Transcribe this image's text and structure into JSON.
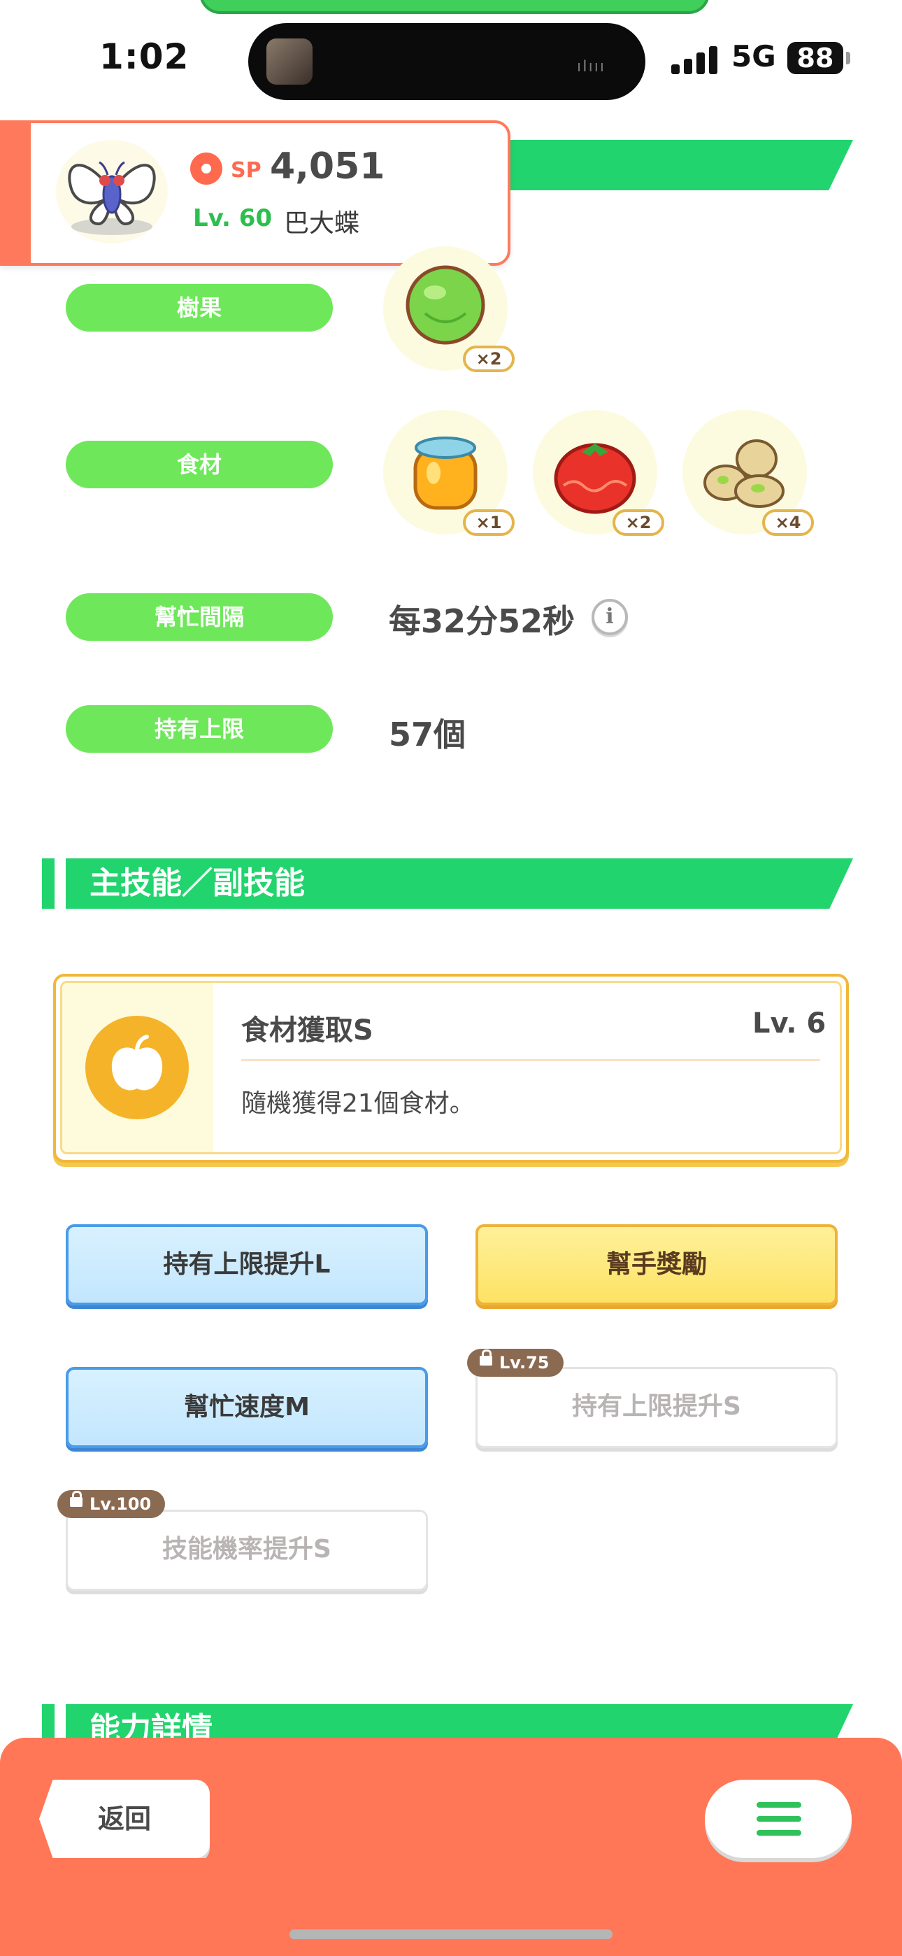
{
  "status_bar": {
    "time": "1:02",
    "network": "5G",
    "battery": "88"
  },
  "pokemon": {
    "sp_label": "SP",
    "sp_value": "4,051",
    "level": "Lv. 60",
    "name": "巴大蝶"
  },
  "rows": {
    "berry_label": "樹果",
    "berry": {
      "icon": "green-berry-icon",
      "count": "×2"
    },
    "ingredients_label": "食材",
    "ingredients": [
      {
        "icon": "honey-jar-icon",
        "count": "×1"
      },
      {
        "icon": "tomato-icon",
        "count": "×2"
      },
      {
        "icon": "beans-icon",
        "count": "×4"
      }
    ],
    "help_interval_label": "幫忙間隔",
    "help_interval_value": "每32分52秒",
    "capacity_label": "持有上限",
    "capacity_value": "57個"
  },
  "skills_section": {
    "title": "主技能／副技能"
  },
  "main_skill": {
    "name": "食材獲取S",
    "level": "Lv. 6",
    "description": "隨機獲得21個食材。",
    "icon": "apple-icon"
  },
  "sub_skills": [
    {
      "label": "持有上限提升L",
      "style": "blue",
      "unlock": ""
    },
    {
      "label": "幫手獎勵",
      "style": "yellow",
      "unlock": ""
    },
    {
      "label": "幫忙速度M",
      "style": "blue",
      "unlock": ""
    },
    {
      "label": "持有上限提升S",
      "style": "locked",
      "unlock": "Lv.75"
    },
    {
      "label": "技能機率提升S",
      "style": "locked",
      "unlock": "Lv.100"
    }
  ],
  "ability_section": {
    "title": "能力詳情"
  },
  "bottom_bar": {
    "back_label": "返回",
    "menu_icon": "hamburger-menu-icon"
  },
  "colors": {
    "accent_green": "#22d46e",
    "pill_green": "#6ee85a",
    "bottom_orange": "#ff7757",
    "gold": "#f0b83a",
    "blue": "#4a9be8"
  }
}
